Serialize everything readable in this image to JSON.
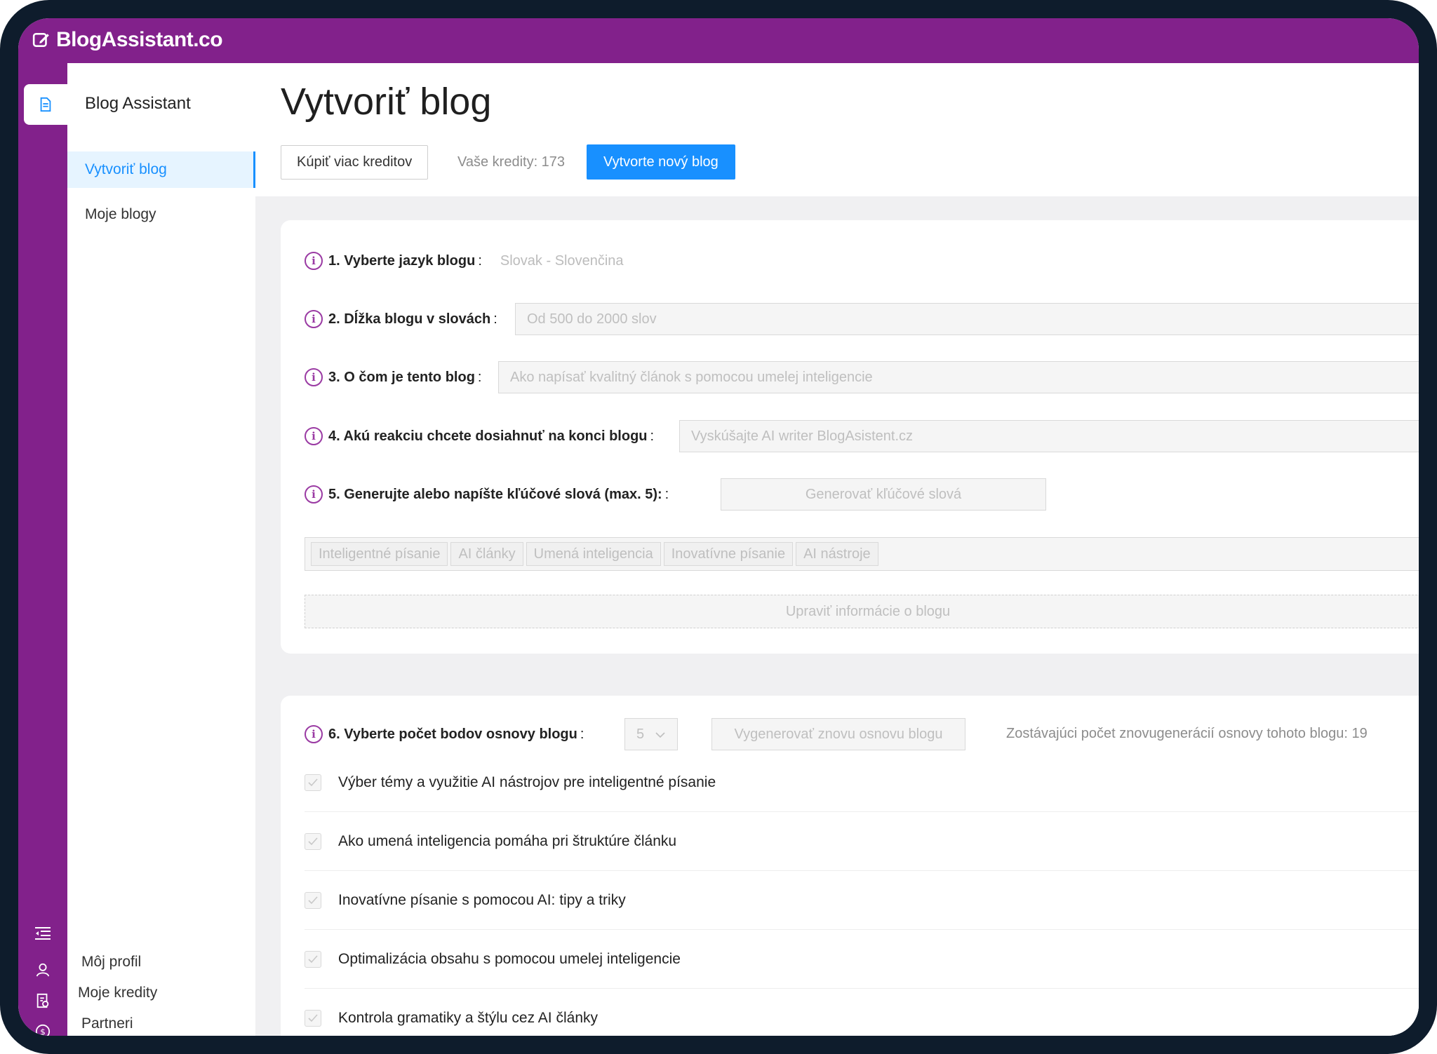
{
  "app": {
    "logo_text": "BlogAssistant.co"
  },
  "sidebar": {
    "title": "Blog Assistant",
    "items": [
      {
        "label": "Vytvoriť blog",
        "active": true
      },
      {
        "label": "Moje blogy",
        "active": false
      }
    ],
    "bottom": [
      {
        "label": "Môj profil",
        "icon": "user-icon"
      },
      {
        "label": "Moje kredity",
        "icon": "credits-icon"
      },
      {
        "label": "Partneri",
        "icon": "dollar-icon"
      }
    ]
  },
  "header": {
    "title": "Vytvoriť blog",
    "buy_credits": "Kúpiť viac kreditov",
    "credits": "Vaše kredity: 173",
    "new_blog": "Vytvorte nový blog"
  },
  "form": {
    "q1": {
      "label": "1. Vyberte jazyk blogu",
      "value": "Slovak - Slovenčina"
    },
    "q2": {
      "label": "2. Dĺžka blogu v slovách",
      "placeholder": "Od 500 do 2000 slov"
    },
    "q3": {
      "label": "3. O čom je tento blog",
      "placeholder": "Ako napísať kvalitný článok s pomocou umelej inteligencie"
    },
    "q4": {
      "label": "4. Akú reakciu chcete dosiahnuť na konci blogu",
      "placeholder": "Vyskúšajte AI writer BlogAsistent.cz"
    },
    "q5": {
      "label": "5. Generujte alebo napíšte kľúčové slová (max. 5):",
      "button": "Generovať kľúčové slová"
    },
    "keywords": [
      "Inteligentné písanie",
      "AI články",
      "Umená inteligencia",
      "Inovatívne písanie",
      "AI nástroje"
    ],
    "edit_button": "Upraviť informácie o blogu",
    "colon": ":"
  },
  "outline": {
    "label": "6. Vyberte počet bodov osnovy blogu",
    "count": "5",
    "regenerate": "Vygenerovať znovu osnovu blogu",
    "remaining": "Zostávajúci počet znovugenerácií osnovy tohoto blogu: 19",
    "items": [
      "Výber témy a využitie AI nástrojov pre inteligentné písanie",
      "Ako umená inteligencia pomáha pri štruktúre článku",
      "Inovatívne písanie s pomocou AI: tipy a triky",
      "Optimalizácia obsahu s pomocou umelej inteligencie",
      "Kontrola gramatiky a štýlu cez AI články"
    ]
  },
  "colors": {
    "brand": "#82218b",
    "primary": "#1890ff",
    "info": "#9a3aa3"
  }
}
